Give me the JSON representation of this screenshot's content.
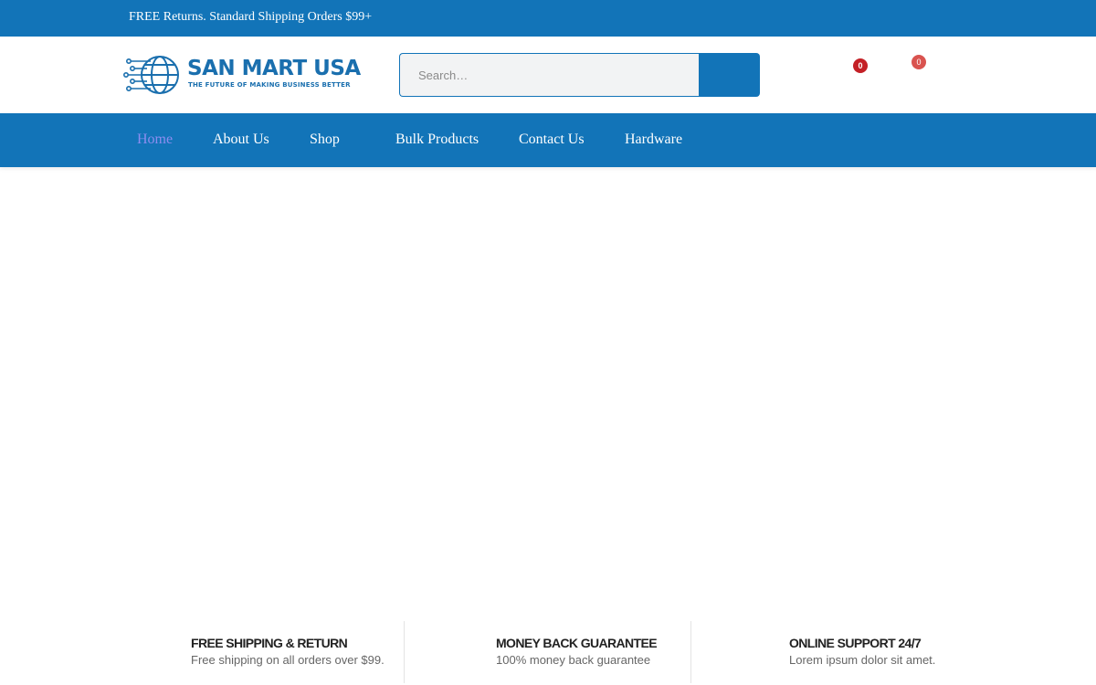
{
  "topbar": {
    "promo_text": "FREE Returns. Standard Shipping Orders $99+"
  },
  "header": {
    "logo": {
      "brand": "SAN MART USA",
      "tagline": "THE FUTURE OF MAKING BUSINESS BETTER",
      "icon": "circuit-globe-icon"
    },
    "search": {
      "placeholder": "Search…",
      "value": "",
      "icon": "search-icon"
    },
    "wishlist": {
      "count": "0",
      "icon": "heart-icon"
    },
    "cart": {
      "count": "0",
      "icon": "cart-icon"
    }
  },
  "nav": {
    "items": [
      {
        "label": "Home",
        "active": true
      },
      {
        "label": "About Us",
        "active": false
      },
      {
        "label": "Shop",
        "active": false
      },
      {
        "label": "Bulk Products",
        "active": false
      },
      {
        "label": "Contact Us",
        "active": false
      },
      {
        "label": "Hardware",
        "active": false
      }
    ]
  },
  "features": [
    {
      "title": "FREE SHIPPING & RETURN",
      "description": "Free shipping on all orders over $99."
    },
    {
      "title": "MONEY BACK GUARANTEE",
      "description": "100% money back guarantee"
    },
    {
      "title": "ONLINE SUPPORT 24/7",
      "description": "Lorem ipsum dolor sit amet."
    }
  ],
  "colors": {
    "primary": "#1274b8",
    "active_nav": "#8d8df0",
    "badge_red": "#c42026",
    "badge_soft_red": "#d9534f"
  }
}
